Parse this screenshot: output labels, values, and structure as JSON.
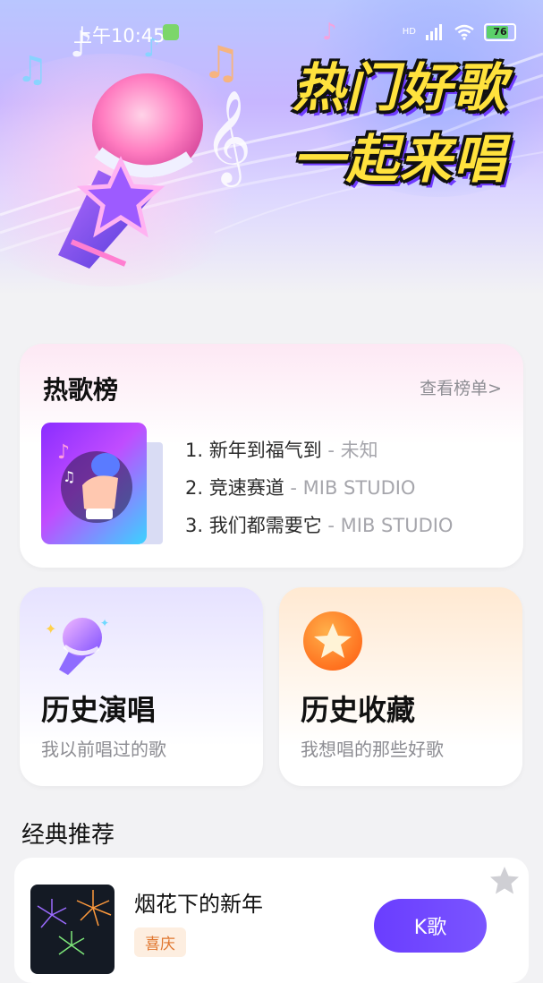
{
  "status_bar": {
    "time": "上午10:45",
    "network": "HD",
    "battery": "76"
  },
  "banner": {
    "line1": "热门好歌",
    "line2": "一起来唱"
  },
  "hot_chart": {
    "title": "热歌榜",
    "more_link": "查看榜单>",
    "songs": [
      {
        "title": "1. 新年到福气到",
        "artist": " - 未知"
      },
      {
        "title": "2. 竞速赛道",
        "artist": " - MIB STUDIO"
      },
      {
        "title": "3. 我们都需要它",
        "artist": " - MIB STUDIO"
      }
    ]
  },
  "history_sing": {
    "title": "历史演唱",
    "subtitle": "我以前唱过的歌"
  },
  "history_fav": {
    "title": "历史收藏",
    "subtitle": "我想唱的那些好歌"
  },
  "classic": {
    "section_title": "经典推荐",
    "items": [
      {
        "title": "烟花下的新年",
        "tag": "喜庆",
        "action": "K歌"
      }
    ]
  },
  "colors": {
    "accent": "#6a3dff",
    "banner_text": "#ffe23d",
    "tag_text": "#e0752d"
  }
}
